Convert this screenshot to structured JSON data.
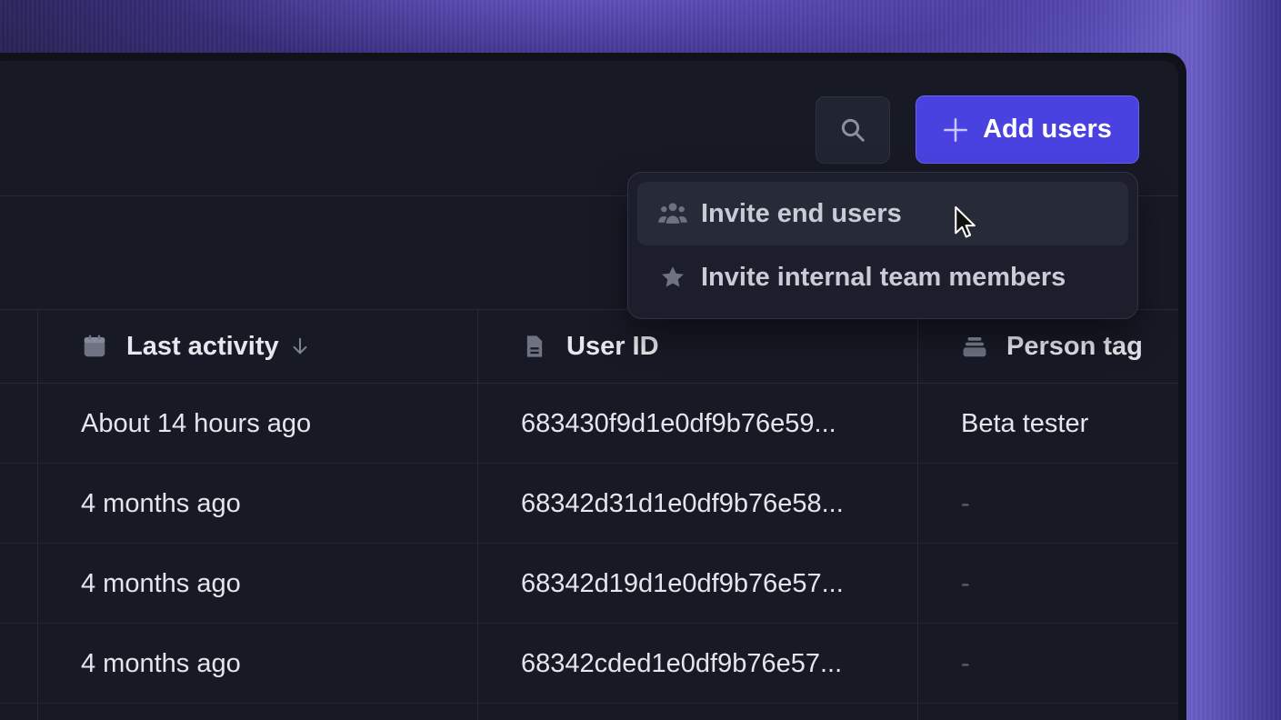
{
  "toolbar": {
    "search_icon": "search-icon",
    "add_users_label": "Add users",
    "add_icon": "plus-icon"
  },
  "dropdown": {
    "items": [
      {
        "label": "Invite end users",
        "icon": "users-group-icon",
        "hovered": true
      },
      {
        "label": "Invite internal team members",
        "icon": "star-icon",
        "hovered": false
      }
    ]
  },
  "table": {
    "columns": [
      {
        "label": "Last activity",
        "icon": "calendar-icon",
        "sort": "descending"
      },
      {
        "label": "User ID",
        "icon": "document-icon"
      },
      {
        "label": "Person tag",
        "icon": "tag-stack-icon"
      }
    ],
    "rows": [
      {
        "last_activity": "About 14 hours ago",
        "user_id": "683430f9d1e0df9b76e59...",
        "person_tag": "Beta tester"
      },
      {
        "last_activity": "4 months ago",
        "user_id": "68342d31d1e0df9b76e58...",
        "person_tag": "-"
      },
      {
        "last_activity": "4 months ago",
        "user_id": "68342d19d1e0df9b76e57...",
        "person_tag": "-"
      },
      {
        "last_activity": "4 months ago",
        "user_id": "68342cded1e0df9b76e57...",
        "person_tag": "-"
      }
    ]
  },
  "colors": {
    "accent": "#4a41e1",
    "panel": "#171a25",
    "menu": "#1c1f2b"
  }
}
